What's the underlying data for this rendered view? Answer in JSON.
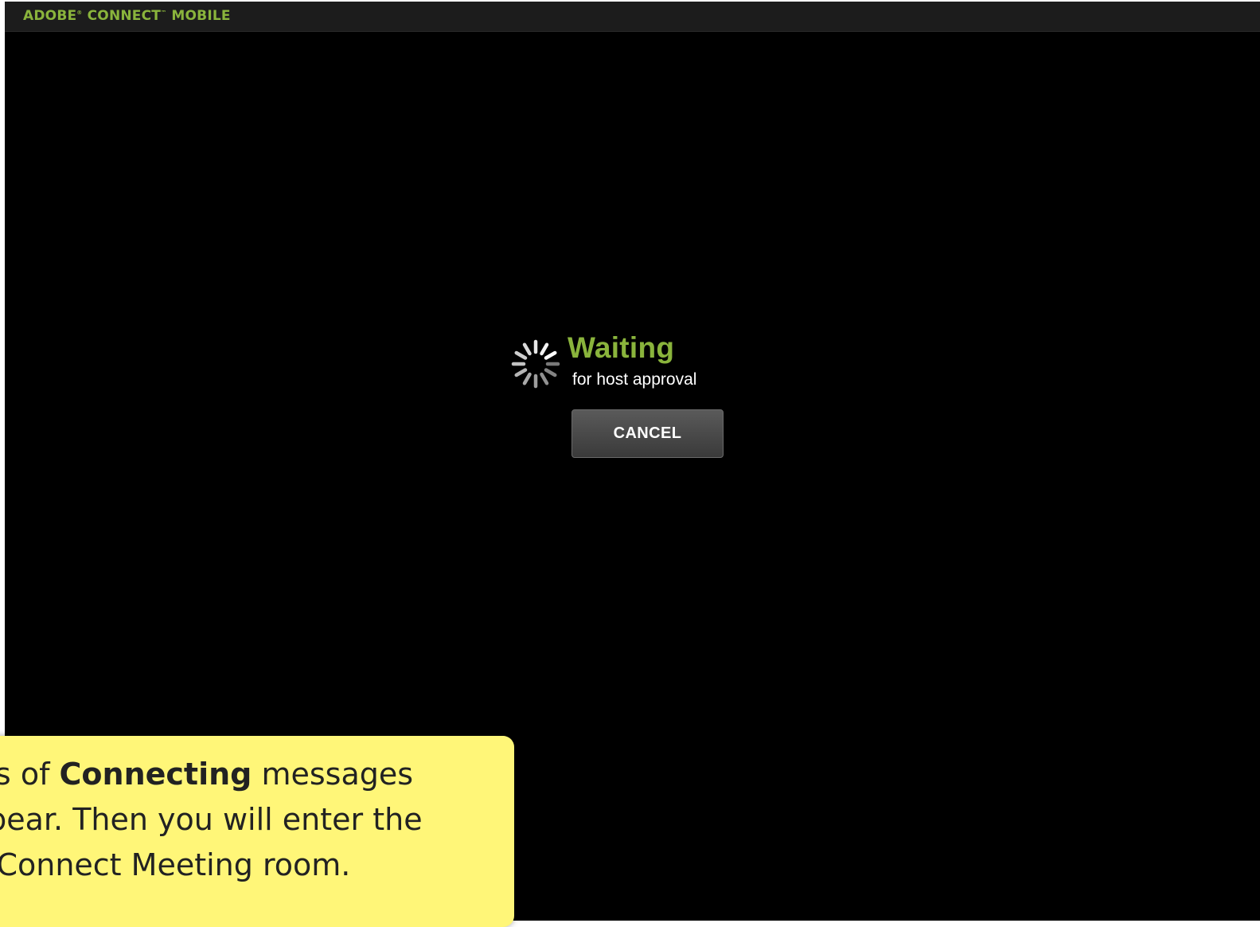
{
  "app": {
    "brand_part1": "ADOBE",
    "brand_mark1": "®",
    "brand_part2": " CONNECT",
    "brand_mark2": "™",
    "brand_part3": " MOBILE",
    "brand_color": "#8ab43c"
  },
  "status": {
    "title": "Waiting",
    "subtitle": "for host approval",
    "spinner_icon": "loading-spinner-icon"
  },
  "cancel_button": {
    "label": "CANCEL"
  },
  "callout": {
    "line1_prefix": "ies of ",
    "line1_bold": "Connecting",
    "line1_suffix": " messages",
    "line2": "ppear. Then you will enter the",
    "line3": "e Connect Meeting room.",
    "background": "#fff678"
  }
}
